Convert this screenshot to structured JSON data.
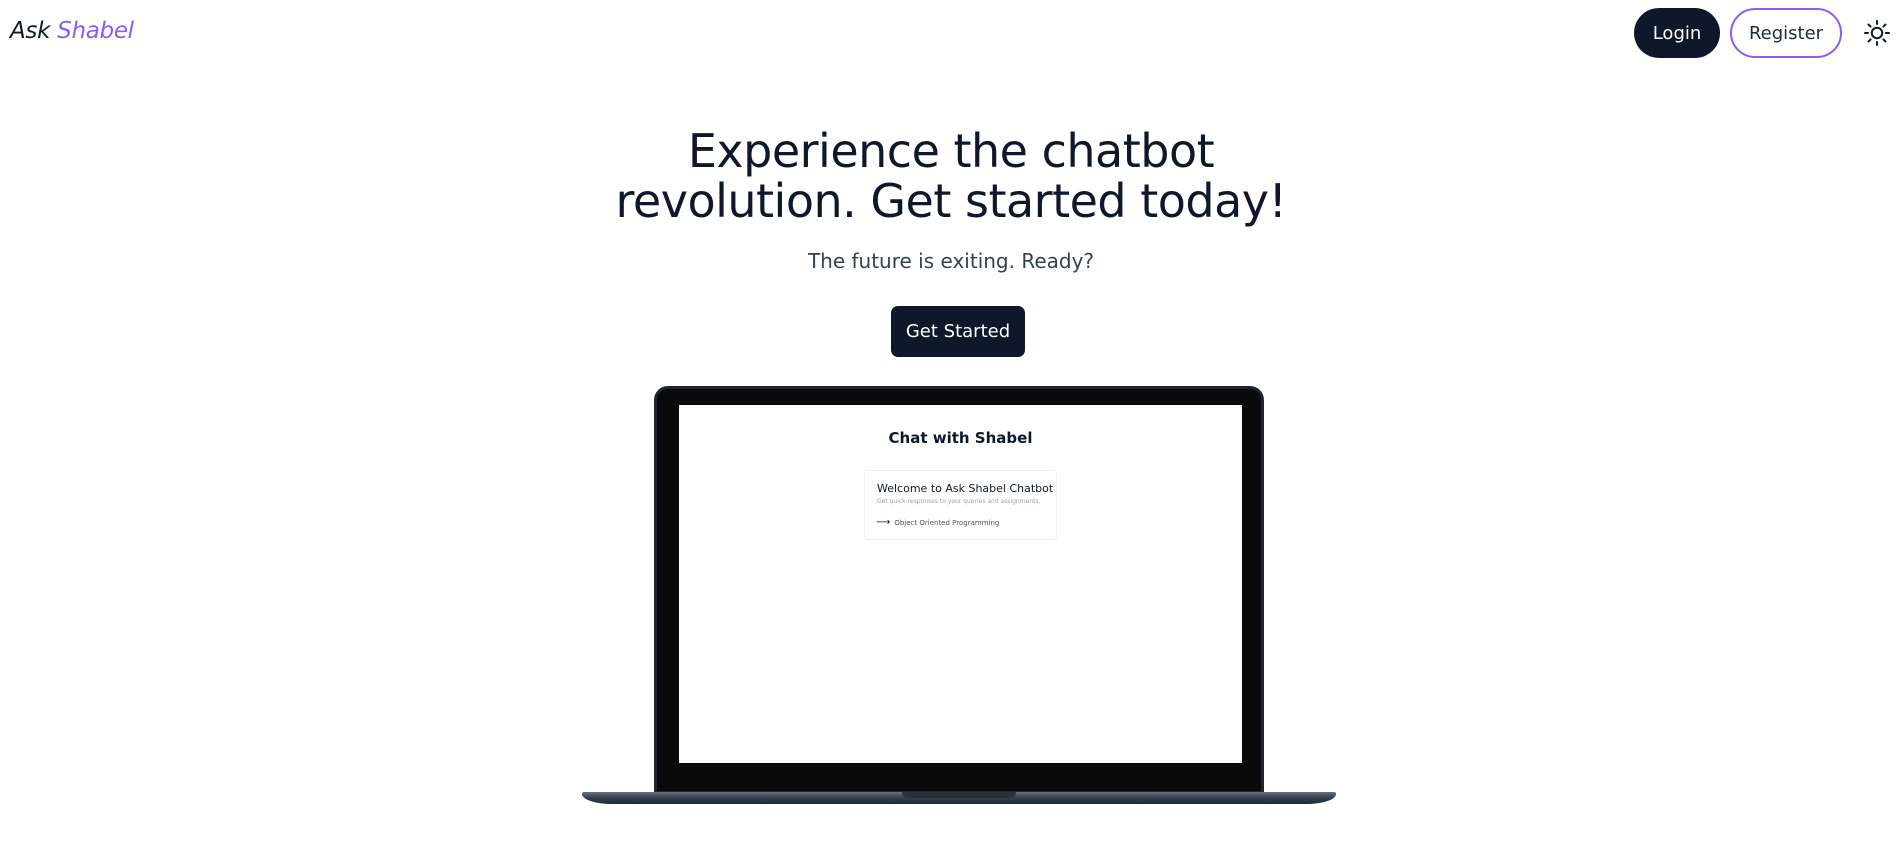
{
  "header": {
    "logo_prefix": "Ask",
    "logo_highlight": "Shabel",
    "login_label": "Login",
    "register_label": "Register",
    "theme_icon": "sun-icon"
  },
  "hero": {
    "title_line1": "Experience the chatbot",
    "title_line2": "revolution. Get started today!",
    "subtitle": "The future is exiting. Ready?",
    "cta_label": "Get Started"
  },
  "preview": {
    "screen_title": "Chat with Shabel",
    "card_title": "Welcome to Ask Shabel Chatbot",
    "card_description": "Get quick responses to your queries and assignments.",
    "suggestion_icon": "arrow-right-icon",
    "suggestion_label": "Object Oriented Programming"
  },
  "colors": {
    "brand_dark": "#0f172a",
    "accent_purple": "#8b5cf6"
  }
}
